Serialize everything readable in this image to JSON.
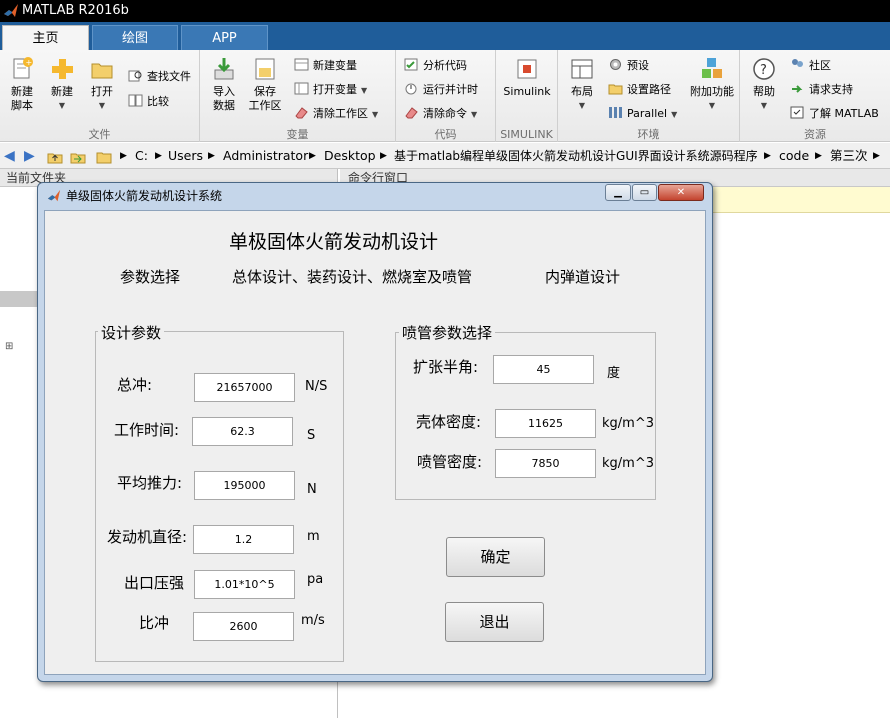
{
  "app": {
    "title": "MATLAB R2016b"
  },
  "ribbon": {
    "tabs": [
      "主页",
      "绘图",
      "APP"
    ],
    "sections": {
      "file": "文件",
      "variable": "变量",
      "code": "代码",
      "simulink": "SIMULINK",
      "env": "环境",
      "resources": "资源"
    },
    "buttons": {
      "new_script": "新建\n脚本",
      "new_script_l1": "新建",
      "new_script_l2": "脚本",
      "new": "新建",
      "open": "打开",
      "find_files": "查找文件",
      "compare": "比较",
      "import_l1": "导入",
      "import_l2": "数据",
      "save_l1": "保存",
      "save_l2": "工作区",
      "new_variable": "新建变量",
      "open_variable": "打开变量",
      "clear_workspace": "清除工作区",
      "analyze_code": "分析代码",
      "run_time": "运行并计时",
      "clear_commands": "清除命令",
      "simulink": "Simulink",
      "layout": "布局",
      "preferences": "预设",
      "set_path": "设置路径",
      "parallel": "Parallel",
      "addons": "附加功能",
      "help": "帮助",
      "community": "社区",
      "request_support": "请求支持",
      "learn_matlab": "了解 MATLAB"
    }
  },
  "address": {
    "crumbs": [
      "C:",
      "Users",
      "Administrator",
      "Desktop",
      "基于matlab编程单级固体火箭发动机设计GUI界面设计系统源码程序",
      "code",
      "第三次"
    ]
  },
  "panels": {
    "current_folder": "当前文件夹",
    "command_window": "命令行窗口"
  },
  "dialog": {
    "title": "单级固体火箭发动机设计系统",
    "heading": "单极固体火箭发动机设计",
    "menu": [
      "参数选择",
      "总体设计、装药设计、燃烧室及喷管",
      "内弹道设计"
    ],
    "design_group": {
      "title": "设计参数",
      "fields": [
        {
          "label": "总冲:",
          "value": "21657000",
          "unit": "N/S"
        },
        {
          "label": "工作时间:",
          "value": "62.3",
          "unit": "S"
        },
        {
          "label": "平均推力:",
          "value": "195000",
          "unit": "N"
        },
        {
          "label": "发动机直径:",
          "value": "1.2",
          "unit": "m"
        },
        {
          "label": "出口压强",
          "value": "1.01*10^5",
          "unit": "pa"
        },
        {
          "label": "比冲",
          "value": "2600",
          "unit": "m/s"
        }
      ]
    },
    "nozzle_group": {
      "title": "喷管参数选择",
      "fields": [
        {
          "label": "扩张半角:",
          "value": "45",
          "unit": "度"
        },
        {
          "label": "壳体密度:",
          "value": "11625",
          "unit": "kg/m^3"
        },
        {
          "label": "喷管密度:",
          "value": "7850",
          "unit": "kg/m^3"
        }
      ]
    },
    "confirm": "确定",
    "exit": "退出"
  },
  "colors": {
    "ribbon_tab_bar": "#1f5d9a",
    "dialog_frame": "#c5d6ea",
    "dialog_client": "#efefef",
    "command_prompt_bg": "#fffbd0"
  }
}
